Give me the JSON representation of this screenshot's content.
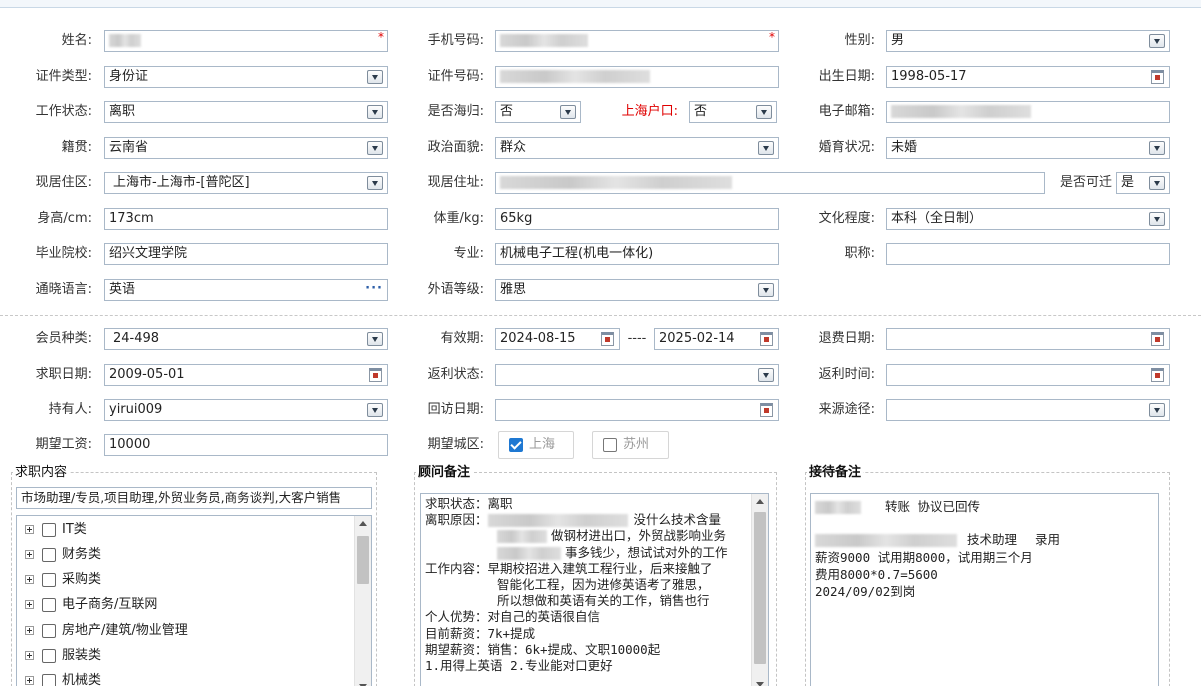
{
  "form": {
    "name": {
      "label": "姓名:",
      "value": ""
    },
    "phone": {
      "label": "手机号码:",
      "value": ""
    },
    "gender": {
      "label": "性别:",
      "value": "男"
    },
    "id_type": {
      "label": "证件类型:",
      "value": "身份证"
    },
    "id_number": {
      "label": "证件号码:",
      "value": ""
    },
    "birth_date": {
      "label": "出生日期:",
      "value": "1998-05-17"
    },
    "work_status": {
      "label": "工作状态:",
      "value": "离职"
    },
    "returnee": {
      "label": "是否海归:",
      "value": "否"
    },
    "sh_hukou": {
      "label": "上海户口:",
      "value": "否"
    },
    "email": {
      "label": "电子邮箱:",
      "value": ""
    },
    "native_place": {
      "label": "籍贯:",
      "value": "云南省"
    },
    "political": {
      "label": "政治面貌:",
      "value": "群众"
    },
    "marital": {
      "label": "婚育状况:",
      "value": "未婚"
    },
    "residence_area": {
      "label": "现居住区:",
      "value": "上海市-上海市-[普陀区]"
    },
    "residence_address": {
      "label": "现居住址:",
      "value": ""
    },
    "relocate": {
      "label": "是否可迁",
      "value": "是"
    },
    "height": {
      "label": "身高/cm:",
      "value": "173cm"
    },
    "weight": {
      "label": "体重/kg:",
      "value": "65kg"
    },
    "education": {
      "label": "文化程度:",
      "value": "本科（全日制）"
    },
    "school": {
      "label": "毕业院校:",
      "value": "绍兴文理学院"
    },
    "major": {
      "label": "专业:",
      "value": "机械电子工程(机电一体化)"
    },
    "title": {
      "label": "职称:",
      "value": ""
    },
    "language": {
      "label": "通晓语言:",
      "value": "英语"
    },
    "language_level": {
      "label": "外语等级:",
      "value": "雅思"
    }
  },
  "member": {
    "type": {
      "label": "会员种类:",
      "value": "24-498"
    },
    "valid": {
      "label": "有效期:",
      "from": "2024-08-15",
      "sep": "----",
      "to": "2025-02-14"
    },
    "refund_date": {
      "label": "退费日期:",
      "value": ""
    },
    "job_date": {
      "label": "求职日期:",
      "value": "2009-05-01"
    },
    "rebate_status": {
      "label": "返利状态:",
      "value": ""
    },
    "rebate_time": {
      "label": "返利时间:",
      "value": ""
    },
    "holder": {
      "label": "持有人:",
      "value": "yirui009"
    },
    "visit_date": {
      "label": "回访日期:",
      "value": ""
    },
    "source": {
      "label": "来源途径:",
      "value": ""
    },
    "salary": {
      "label": "期望工资:",
      "value": "10000"
    },
    "city": {
      "label": "期望城区:",
      "options": [
        {
          "label": "上海",
          "checked": true
        },
        {
          "label": "苏州",
          "checked": false
        }
      ]
    }
  },
  "job_content": {
    "title": "求职内容",
    "summary": "市场助理/专员,项目助理,外贸业务员,商务谈判,大客户销售",
    "categories": [
      "IT类",
      "财务类",
      "采购类",
      "电子商务/互联网",
      "房地产/建筑/物业管理",
      "服装类",
      "机械类"
    ]
  },
  "consultant_note": {
    "title": "顾问备注",
    "lines": [
      {
        "text": "求职状态：离职",
        "indent": false
      },
      {
        "text": "离职原因：",
        "indent": false,
        "tail": "没什么技术含量"
      },
      {
        "text": "做钢材进出口，外贸战影响业务",
        "indent": true
      },
      {
        "text": "事多钱少，想试试对外的工作",
        "indent": true
      },
      {
        "text": "工作内容：早期校招进入建筑工程行业，后来接触了",
        "indent": false
      },
      {
        "text": "智能化工程，因为进修英语考了雅思，",
        "indent": true
      },
      {
        "text": "所以想做和英语有关的工作，销售也行",
        "indent": true
      },
      {
        "text": "个人优势：对自己的英语很自信",
        "indent": false
      },
      {
        "text": "目前薪资：7k+提成",
        "indent": false
      },
      {
        "text": "期望薪资：销售：6k+提成、文职10000起",
        "indent": false
      },
      {
        "text": "1.用得上英语 2.专业能对口更好",
        "indent": false
      }
    ]
  },
  "reception_note": {
    "title": "接待备注",
    "line1": "转账  协议已回传",
    "line2_a": "技术助理",
    "line2_b": "录用",
    "line3": "薪资9000 试用期8000，试用期三个月",
    "line4": "费用8000*0.7=5600",
    "line5": "2024/09/02到岗"
  },
  "colors": {
    "accent": "#1e78d2",
    "required": "#e00000",
    "border": "#a9b8c8"
  }
}
